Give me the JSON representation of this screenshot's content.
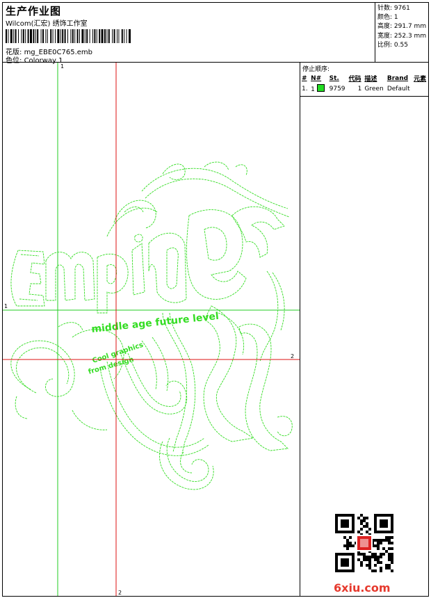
{
  "header": {
    "title": "生产作业图",
    "subtitle": "Wilcom(汇宏) 绣饰工作室",
    "design_label": "花版:",
    "design_file": "mg_EBE0C765.emb",
    "colorway_label": "色位:",
    "colorway": "Colorway 1"
  },
  "stats": {
    "stitches_label": "针数:",
    "stitches": "9761",
    "colors_label": "颜色:",
    "colors": "1",
    "height_label": "高度:",
    "height": "291.7 mm",
    "width_label": "宽度:",
    "width": "252.3 mm",
    "scale_label": "比例:",
    "scale": "0.55"
  },
  "stop_sequence": {
    "title": "停止顺序:",
    "columns": [
      "#",
      "N#",
      "St.",
      "代码",
      "描述",
      "Brand",
      "元素"
    ],
    "rows": [
      {
        "index": "1.",
        "n": "1",
        "swatch_color": "#22dd22",
        "stitches": "9759",
        "code": "1",
        "description": "Green",
        "brand": "Default",
        "element": ""
      }
    ]
  },
  "canvas": {
    "axis_v1_label": "1",
    "axis_h1_label": "1",
    "axis_v2_label": "2",
    "axis_h2_label": "2",
    "design_text_1": "middle age future level",
    "design_text_2": "Cool graphics",
    "design_text_3": "from design",
    "guide_green": "#22cc22",
    "guide_red": "#dd1111",
    "stitch_color": "#33dd22"
  },
  "watermark": {
    "site": "6xiu.com"
  }
}
